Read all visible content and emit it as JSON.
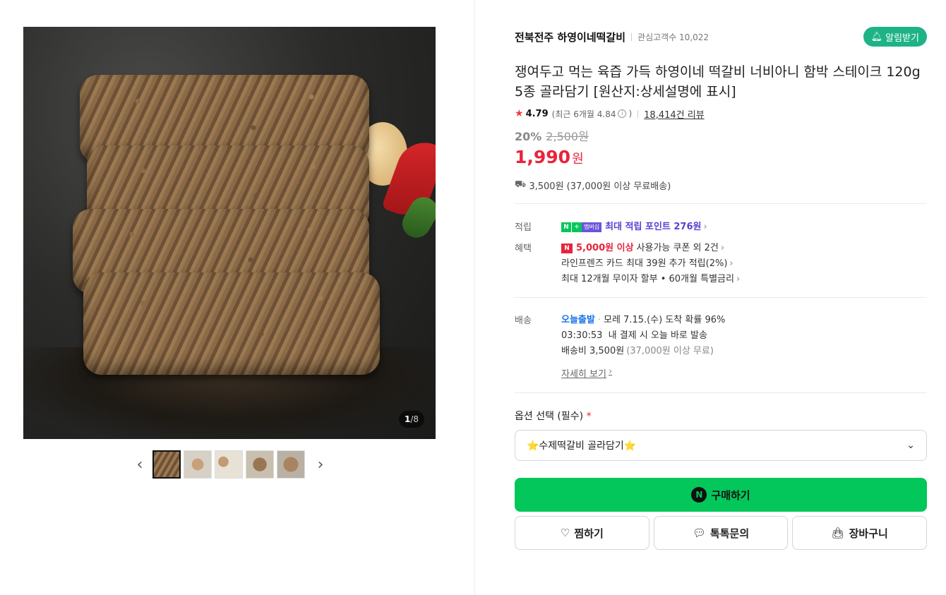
{
  "gallery": {
    "counter_current": "1",
    "counter_total": "8",
    "prev_icon": "chevron-left-icon",
    "next_icon": "chevron-right-icon",
    "thumbnail_count": 5
  },
  "store": {
    "name": "전북전주 하영이네떡갈비",
    "follower_label": "관심고객수 10,022",
    "alarm_button": "알림받기"
  },
  "product": {
    "title": "쟁여두고 먹는 육즙 가득 하영이네 떡갈비 너비아니 함박 스테이크 120g 5종 골라담기 [원산지:상세설명에 표시]",
    "rating": "4.79",
    "recent_rating_prefix": "(최근 6개월 4.84",
    "recent_rating_suffix": ")",
    "review_count": "18,414건 리뷰",
    "discount_percent": "20%",
    "original_price": "2,500원",
    "price": "1,990",
    "price_unit": "원",
    "shipping_summary": "3,500원 (37,000원 이상 무료배송)"
  },
  "points": {
    "label": "적립",
    "badge_n": "N",
    "badge_plus": "+",
    "badge_membership": "멤버십",
    "text": "최대 적립 포인트 276원"
  },
  "benefits": {
    "label": "혜택",
    "coupon_badge": "N",
    "coupon_amount": "5,000원 이상",
    "coupon_text": "사용가능 쿠폰 외 2건",
    "card_text": "라인프렌즈 카드 최대 39원 추가 적립(2%)",
    "installment_text": "최대 12개월 무이자 할부 • 60개월 특별금리"
  },
  "delivery": {
    "label": "배송",
    "today_ship": "오늘출발",
    "arrival_text": "모레 7.15.(수) 도착 확률 96%",
    "deadline_text": "03:30:53  내 결제 시 오늘 바로 발송",
    "fee_text": "배송비 3,500원",
    "fee_note": "(37,000원 이상 무료)",
    "detail_link": "자세히 보기"
  },
  "options": {
    "label": "옵션 선택 (필수)",
    "required_mark": "*",
    "selected_value": "⭐수제떡갈비 골라담기⭐"
  },
  "actions": {
    "buy": "구매하기",
    "buy_n": "N",
    "wish": "찜하기",
    "talk": "톡톡문의",
    "cart": "장바구니"
  },
  "colors": {
    "accent_green": "#03c75a",
    "price_red": "#e8243c",
    "points_purple": "#5542d4",
    "alarm_teal": "#1eb386",
    "today_blue": "#1a73e8"
  }
}
